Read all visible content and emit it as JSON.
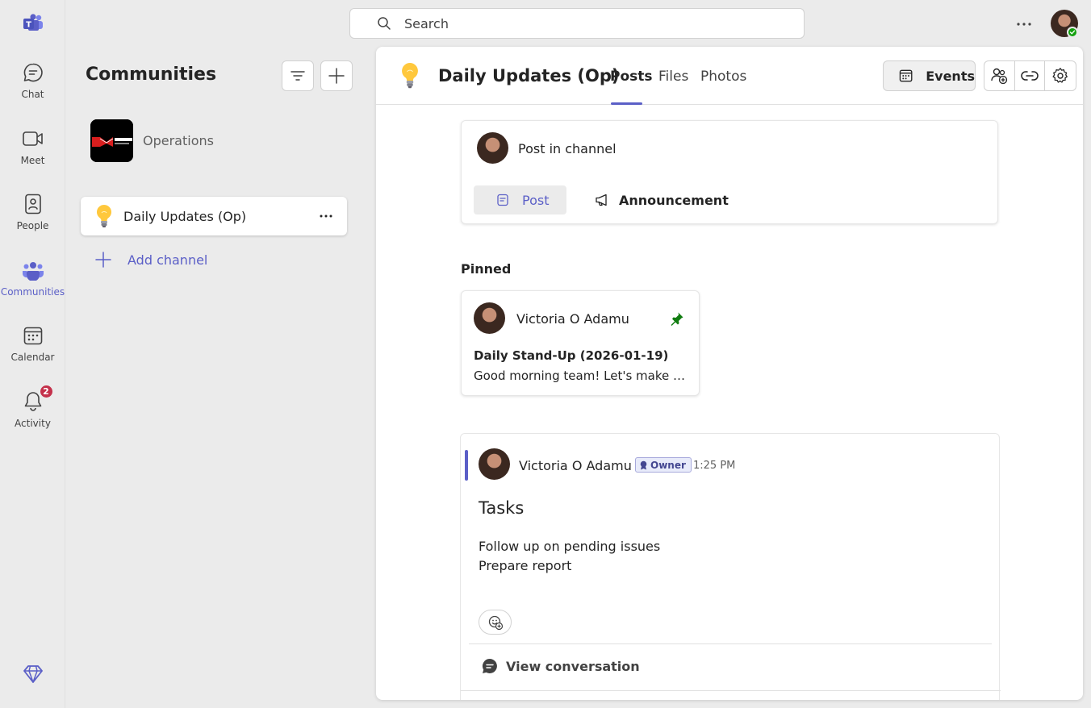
{
  "rail": {
    "items": [
      {
        "label": "Chat",
        "icon": "chat-icon"
      },
      {
        "label": "Meet",
        "icon": "video-icon"
      },
      {
        "label": "People",
        "icon": "people-icon"
      },
      {
        "label": "Communities",
        "icon": "communities-icon",
        "active": true
      },
      {
        "label": "Calendar",
        "icon": "calendar-icon"
      },
      {
        "label": "Activity",
        "icon": "bell-icon",
        "badge": "2"
      }
    ]
  },
  "search": {
    "placeholder": "Search"
  },
  "panel": {
    "title": "Communities",
    "community_name": "Operations",
    "channel_name": "Daily Updates (Op)",
    "add_channel_label": "Add channel"
  },
  "header": {
    "title": "Daily Updates (Op)",
    "tabs": [
      {
        "label": "Posts",
        "active": true
      },
      {
        "label": "Files"
      },
      {
        "label": "Photos"
      }
    ],
    "events_label": "Events"
  },
  "compose": {
    "prompt": "Post in channel",
    "post_label": "Post",
    "announcement_label": "Announcement"
  },
  "pinned": {
    "label": "Pinned",
    "author": "Victoria O Adamu",
    "title": "Daily Stand-Up (2026-01-19)",
    "body": "Good morning team!   Let's make our day productive."
  },
  "message": {
    "author": "Victoria O Adamu",
    "role": "Owner",
    "time": "1:25 PM",
    "title": "Tasks",
    "lines": [
      "Follow up on pending issues",
      "Prepare report"
    ],
    "view_conversation_label": "View conversation"
  },
  "colors": {
    "accent": "#5b5fc7",
    "badge": "#c4314b",
    "presence": "#13a10e"
  }
}
